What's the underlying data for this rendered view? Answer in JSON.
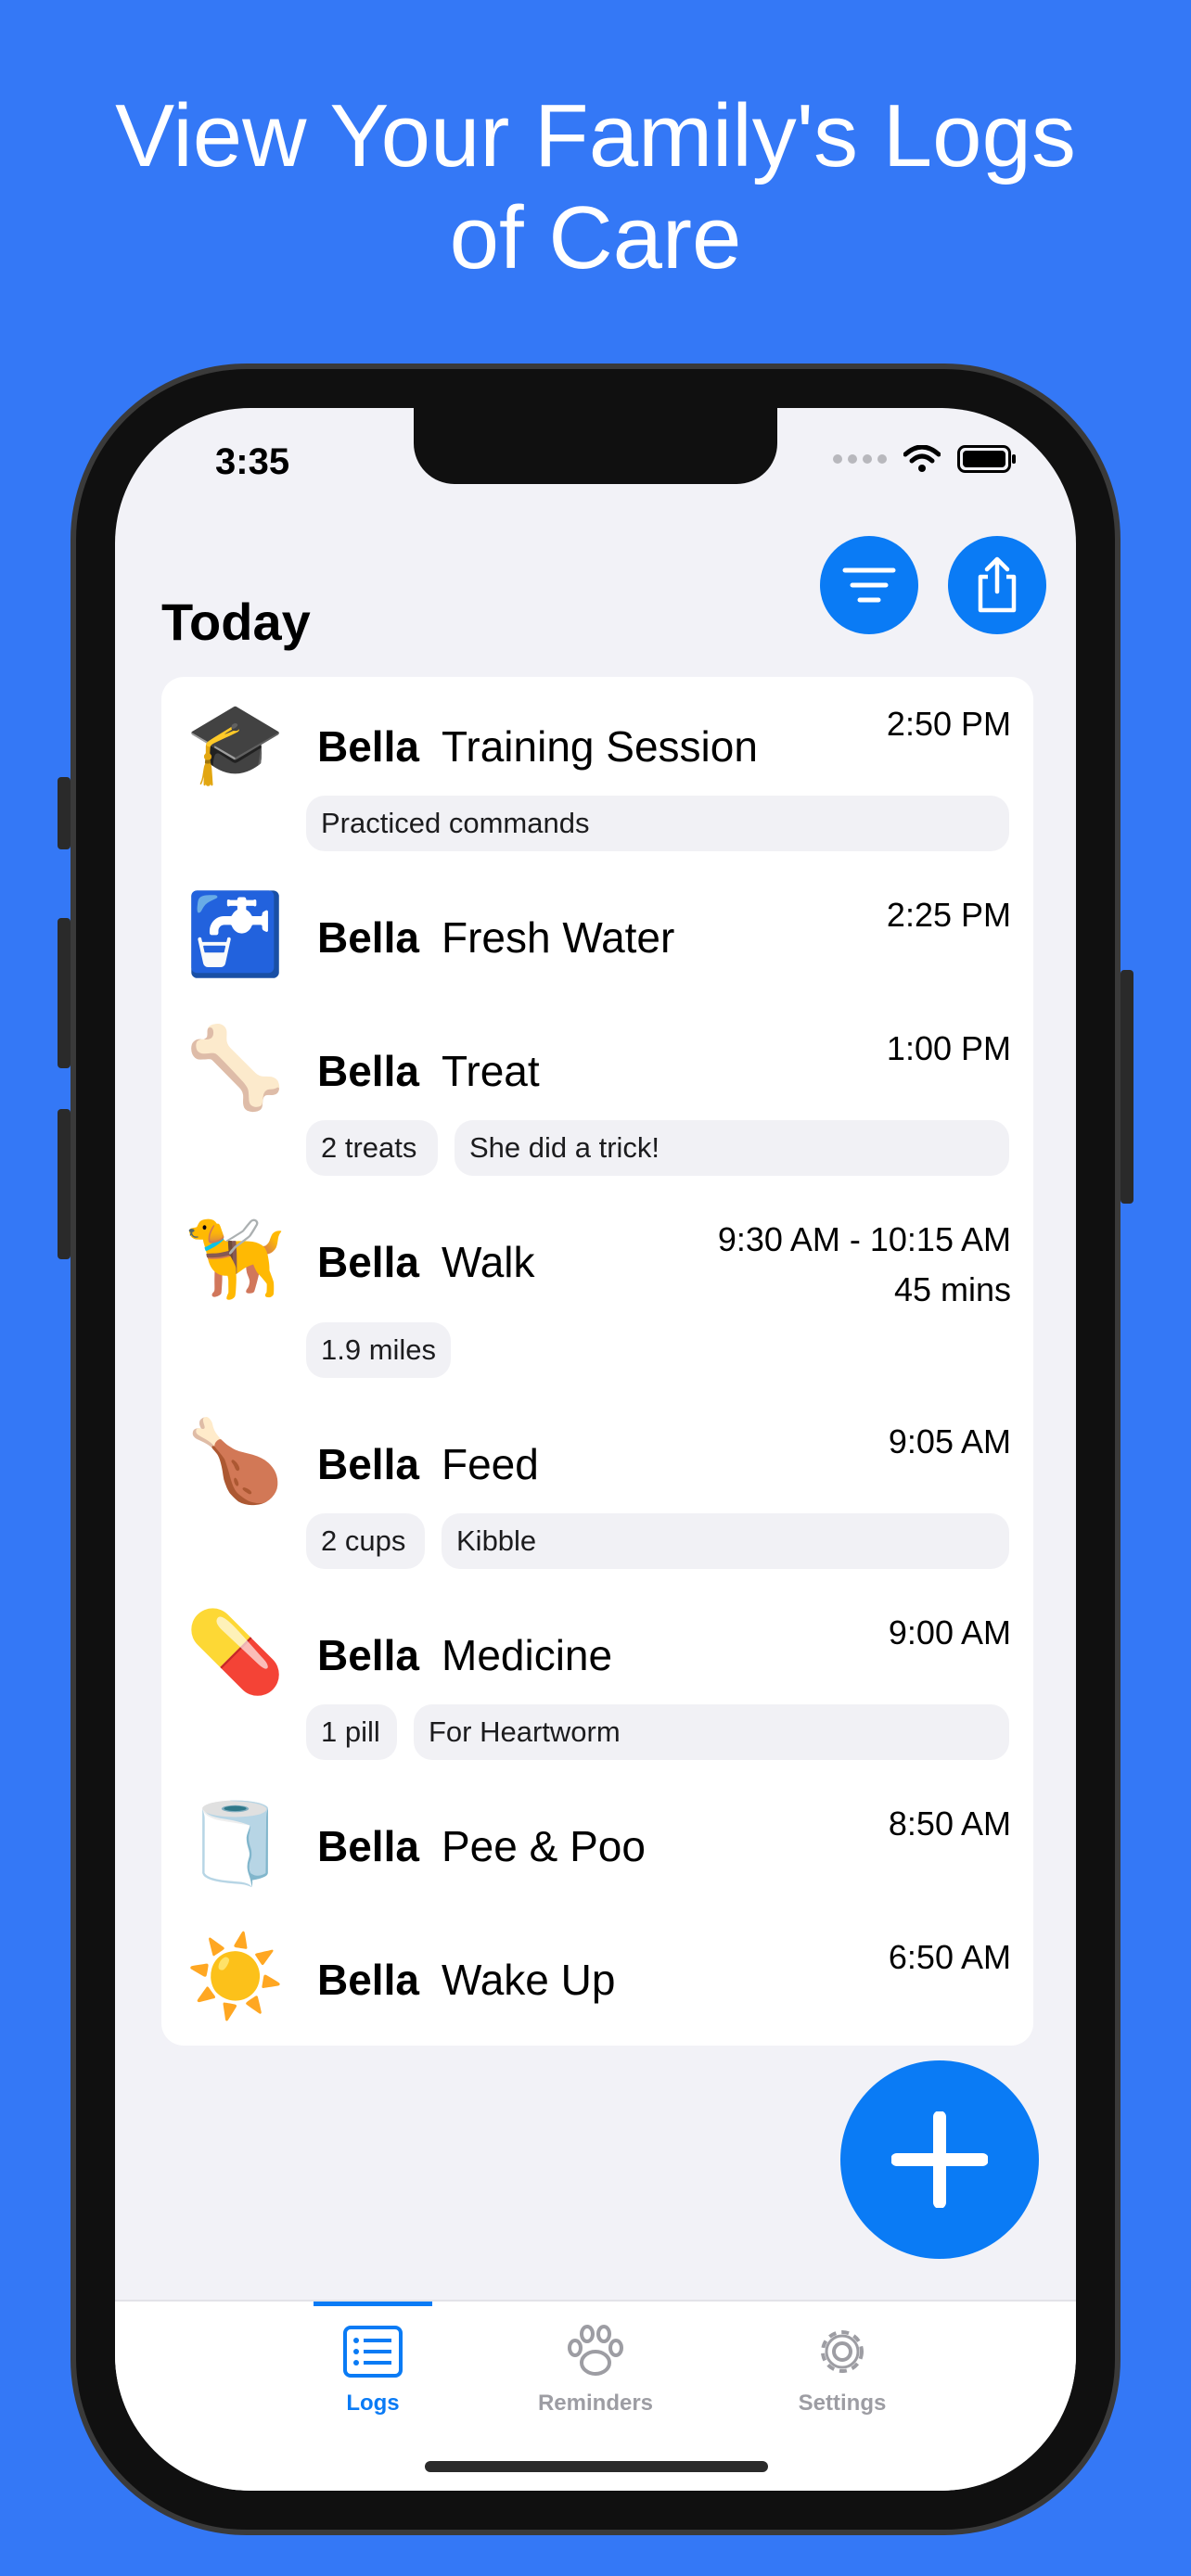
{
  "headline": {
    "line1": "View Your Family's Logs",
    "line2": "of Care"
  },
  "status_bar": {
    "time": "3:35"
  },
  "page": {
    "title": "Today"
  },
  "entries": [
    {
      "icon": "🎓",
      "icon_name": "graduation-cap-icon",
      "pet": "Bella",
      "action": "Training Session",
      "time": "2:50 PM",
      "pills": [
        "Practiced commands"
      ]
    },
    {
      "icon": "🚰",
      "icon_name": "water-faucet-icon",
      "pet": "Bella",
      "action": "Fresh Water",
      "time": "2:25 PM",
      "pills": []
    },
    {
      "icon": "🦴",
      "icon_name": "bone-icon",
      "pet": "Bella",
      "action": "Treat",
      "time": "1:00 PM",
      "pills": [
        "2 treats",
        "She did a trick!"
      ]
    },
    {
      "icon": "🦮",
      "icon_name": "guide-dog-icon",
      "pet": "Bella",
      "action": "Walk",
      "time": "9:30 AM - 10:15 AM",
      "duration": "45 mins",
      "pills": [
        "1.9 miles"
      ]
    },
    {
      "icon": "🍗",
      "icon_name": "drumstick-icon",
      "pet": "Bella",
      "action": "Feed",
      "time": "9:05 AM",
      "pills": [
        "2 cups",
        "Kibble"
      ]
    },
    {
      "icon": "💊",
      "icon_name": "pill-icon",
      "pet": "Bella",
      "action": "Medicine",
      "time": "9:00 AM",
      "pills": [
        "1 pill",
        "For Heartworm"
      ]
    },
    {
      "icon": "🧻",
      "icon_name": "toilet-paper-icon",
      "pet": "Bella",
      "action": "Pee & Poo",
      "time": "8:50 AM",
      "pills": []
    },
    {
      "icon": "☀️",
      "icon_name": "sun-icon",
      "pet": "Bella",
      "action": "Wake Up",
      "time": "6:50 AM",
      "pills": []
    }
  ],
  "tabs": [
    {
      "label": "Logs",
      "icon": "logs-list-icon",
      "active": true
    },
    {
      "label": "Reminders",
      "icon": "paw-icon",
      "active": false
    },
    {
      "label": "Settings",
      "icon": "gear-icon",
      "active": false
    }
  ],
  "colors": {
    "background": "#3478f6",
    "accent": "#0a7bf5",
    "screen": "#f2f2f7",
    "inactive_tab": "#9d9da3"
  }
}
